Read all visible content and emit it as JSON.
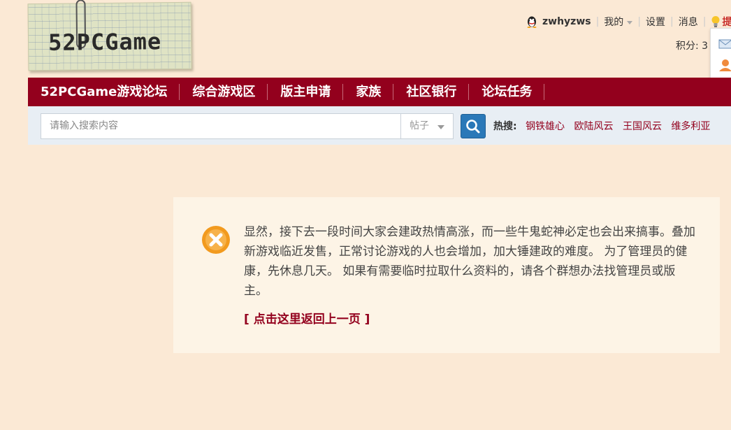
{
  "logo": {
    "text": "52PCGame"
  },
  "user": {
    "name": "zwhyzws",
    "my_label": "我的",
    "settings_label": "设置",
    "messages_label": "消息",
    "tip_label": "提",
    "score_text": "积分: 3"
  },
  "nav": {
    "items": [
      {
        "label": "52PCGame游戏论坛"
      },
      {
        "label": "综合游戏区"
      },
      {
        "label": "版主申请"
      },
      {
        "label": "家族"
      },
      {
        "label": "社区银行"
      },
      {
        "label": "论坛任务"
      }
    ]
  },
  "search": {
    "placeholder": "请输入搜索内容",
    "type_selected": "帖子",
    "hot_label": "热搜:",
    "hot_items": [
      "钢铁雄心",
      "欧陆风云",
      "王国风云",
      "维多利亚"
    ]
  },
  "message": {
    "text": "显然，接下去一段时间大家会建政热情高涨，而一些牛鬼蛇神必定也会出来搞事。叠加新游戏临近发售，正常讨论游戏的人也会增加，加大锤建政的难度。 为了管理员的健康，先休息几天。 如果有需要临时拉取什么资料的，请各个群想办法找管理员或版主。",
    "back_link": "[ 点击这里返回上一页 ]"
  },
  "colors": {
    "background": "#fbe9d5",
    "nav_bg": "#93001d",
    "search_bar_bg": "#e8eef4",
    "search_button": "#2a78b8",
    "hot_link": "#93001d",
    "error_icon": "#f29a1e"
  }
}
